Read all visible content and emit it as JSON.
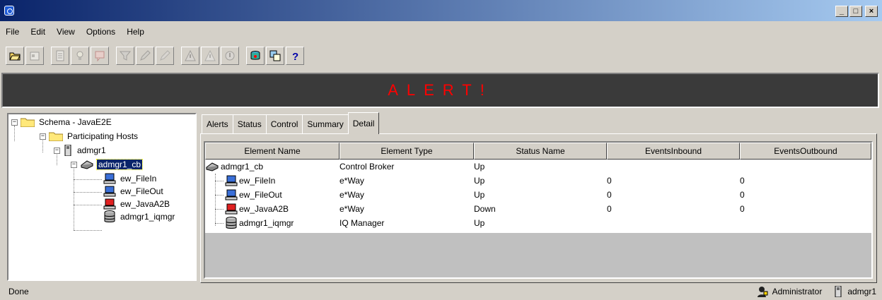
{
  "menu": [
    "File",
    "Edit",
    "View",
    "Options",
    "Help"
  ],
  "window_buttons": [
    "_",
    "□",
    "×"
  ],
  "alert": {
    "text": "ALERT!",
    "color": "#ff0000"
  },
  "tree": {
    "root": "Schema - JavaE2E",
    "hosts": "Participating Hosts",
    "host": "admgr1",
    "broker": "admgr1_cb",
    "children": [
      "ew_FileIn",
      "ew_FileOut",
      "ew_JavaA2B",
      "admgr1_iqmgr"
    ]
  },
  "tabs": [
    "Alerts",
    "Status",
    "Control",
    "Summary",
    "Detail"
  ],
  "table": {
    "columns": [
      "Element Name",
      "Element Type",
      "Status Name",
      "EventsInbound",
      "EventsOutbound"
    ],
    "rows": [
      {
        "name": "admgr1_cb",
        "type": "Control Broker",
        "status": "Up",
        "in": "",
        "out": "",
        "icon": "control-broker-icon"
      },
      {
        "name": "ew_FileIn",
        "type": "e*Way",
        "status": "Up",
        "in": "0",
        "out": "0",
        "icon": "eway-computer-icon"
      },
      {
        "name": "ew_FileOut",
        "type": "e*Way",
        "status": "Up",
        "in": "0",
        "out": "0",
        "icon": "eway-computer-icon"
      },
      {
        "name": "ew_JavaA2B",
        "type": "e*Way",
        "status": "Down",
        "in": "0",
        "out": "0",
        "icon": "eway-down-icon"
      },
      {
        "name": "admgr1_iqmgr",
        "type": "IQ Manager",
        "status": "Up",
        "in": "",
        "out": "",
        "icon": "iq-manager-icon"
      }
    ]
  },
  "status": {
    "text": "Done",
    "user": "Administrator",
    "host": "admgr1"
  }
}
